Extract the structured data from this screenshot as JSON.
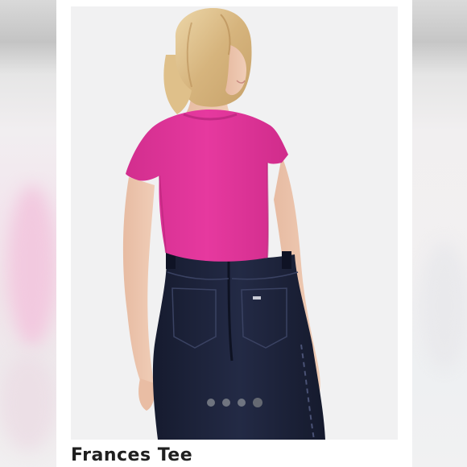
{
  "product": {
    "title": "Frances Tee",
    "image_description_icon": "product-photo",
    "carousel": {
      "total_slides": 4,
      "active_index": 3
    }
  },
  "colors": {
    "tee": "#e0359a",
    "jeans": "#1c2239",
    "background": "#f1f1f2"
  }
}
